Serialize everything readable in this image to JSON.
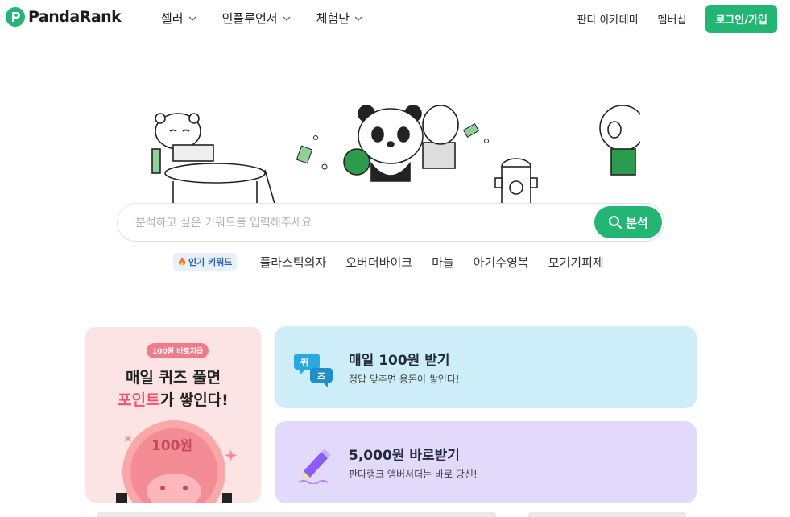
{
  "header": {
    "logo_text": "PandaRank",
    "nav": [
      {
        "label": "셀러"
      },
      {
        "label": "인플루언서"
      },
      {
        "label": "체험단"
      }
    ],
    "academy_label": "판다 아카데미",
    "membership_label": "멤버십",
    "login_label": "로그인/가입"
  },
  "search": {
    "placeholder": "분석하고 싶은 키워드를 입력해주세요",
    "button_label": "분석"
  },
  "popular": {
    "badge_label": "인기 키워드",
    "keywords": [
      "플라스틱의자",
      "오버더바이크",
      "마늘",
      "아기수영복",
      "모기기피제"
    ]
  },
  "promo": {
    "pill": "100원 바로지급",
    "line1": "매일 퀴즈 풀면",
    "line2_highlight": "포인트",
    "line2_rest": "가 쌓인다!",
    "coin_text": "100원"
  },
  "cards": [
    {
      "title": "매일 100원 받기",
      "subtitle": "정답 맞추면 용돈이 쌓인다!",
      "icon": "quiz-bubble-icon"
    },
    {
      "title": "5,000원 바로받기",
      "subtitle": "판다랭크 앰버서더는 바로 당신!",
      "icon": "pencil-icon"
    }
  ],
  "colors": {
    "brand_green": "#22b573",
    "quiz_card_bg": "#cdeef9",
    "ambassador_card_bg": "#e3dafb",
    "promo_bg": "#fde4e4",
    "promo_highlight": "#f0566f"
  }
}
